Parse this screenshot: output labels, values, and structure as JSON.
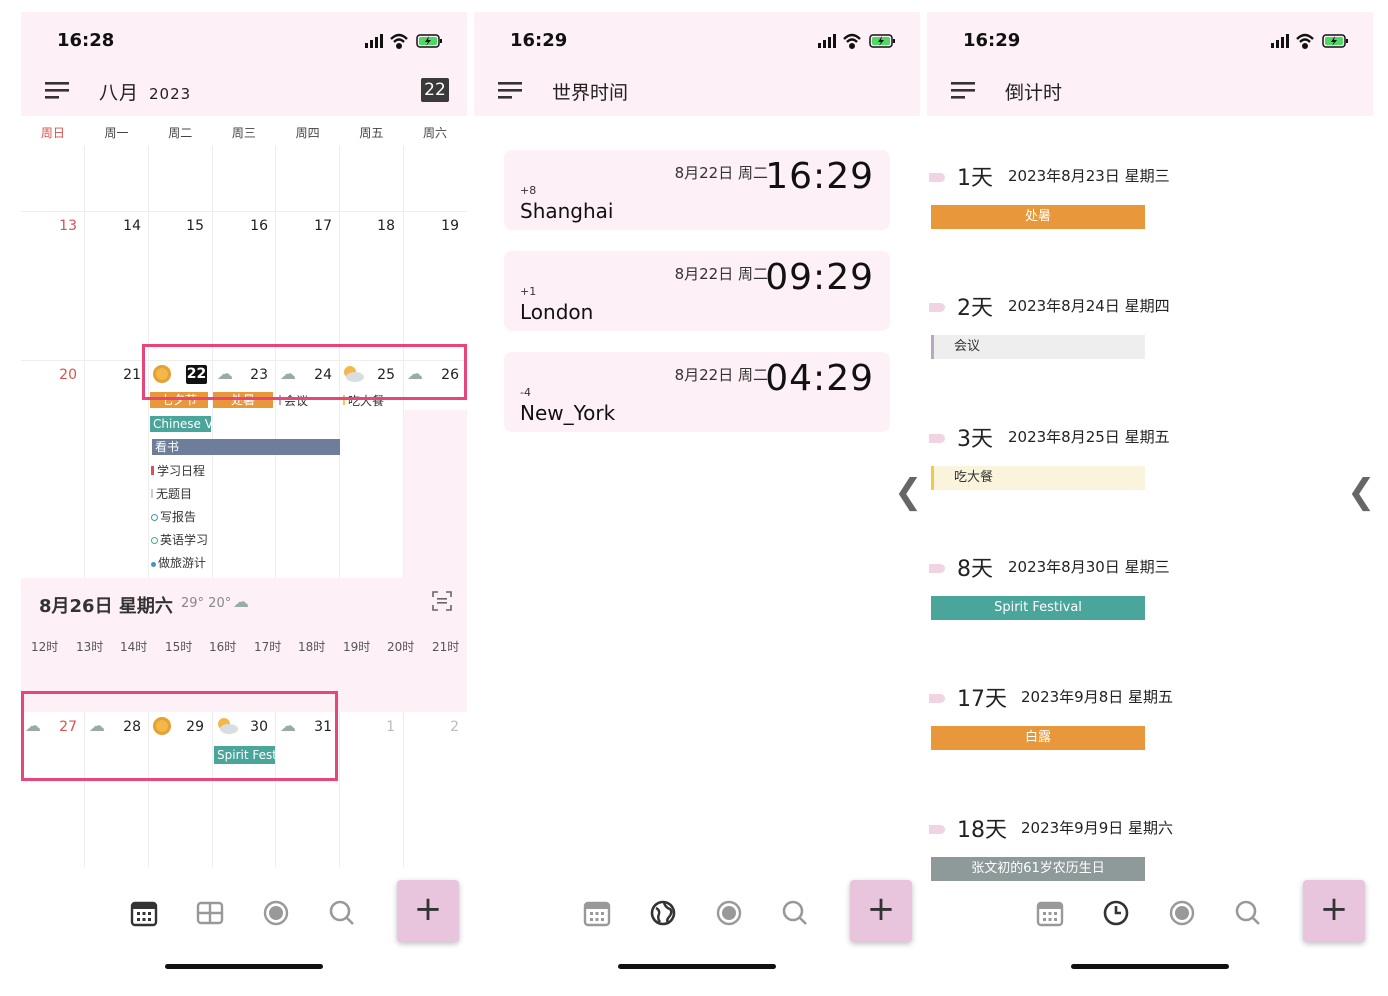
{
  "colors": {
    "accent_pink": "#fdf0f6",
    "highlight": "#e8457a",
    "orange": "#e8983a",
    "teal": "#4aa59a",
    "slate": "#6e7d99",
    "gray": "#8e9a9a"
  },
  "screen1": {
    "time": "16:28",
    "month": "八月",
    "year": "2023",
    "today": "22",
    "weekdays": [
      "周日",
      "周一",
      "周二",
      "周三",
      "周四",
      "周五",
      "周六"
    ],
    "week1": [
      "13",
      "14",
      "15",
      "16",
      "17",
      "18",
      "19"
    ],
    "week2": [
      "20",
      "21",
      "22",
      "23",
      "24",
      "25",
      "26"
    ],
    "week3": [
      "27",
      "28",
      "29",
      "30",
      "31",
      "1",
      "2"
    ],
    "events_week2": {
      "qixi": "七夕节",
      "chushu": "处暑",
      "meeting": "会议",
      "dinner": "吃大餐",
      "chinese": "Chinese V",
      "reading": "看书",
      "study_plan": "学习日程",
      "untitled": "无题目",
      "report": "写报告",
      "english": "英语学习",
      "travel": "做旅游计"
    },
    "day_panel": {
      "title": "8月26日 星期六",
      "temps": "29° 20°",
      "hours": [
        "12时",
        "13时",
        "14时",
        "15时",
        "16时",
        "17时",
        "18时",
        "19时",
        "20时",
        "21时"
      ]
    },
    "event_week3": "Spirit Fest"
  },
  "screen2": {
    "time": "16:29",
    "title": "世界时间",
    "cities": [
      {
        "offset": "+8",
        "city": "Shanghai",
        "date": "8月22日 周二",
        "time": "16:29"
      },
      {
        "offset": "+1",
        "city": "London",
        "date": "8月22日 周二",
        "time": "09:29"
      },
      {
        "offset": "-4",
        "city": "New_York",
        "date": "8月22日 周二",
        "time": "04:29"
      }
    ],
    "chevron": "❮"
  },
  "screen3": {
    "time": "16:29",
    "title": "倒计时",
    "items": [
      {
        "days": "1天",
        "date": "2023年8月23日 星期三",
        "event": "处暑",
        "color": "#e8983a",
        "style": "center"
      },
      {
        "days": "2天",
        "date": "2023年8月24日 星期四",
        "event": "会议",
        "color": "#eeeeee",
        "bar": "#b9a6c6",
        "style": "left"
      },
      {
        "days": "3天",
        "date": "2023年8月25日 星期五",
        "event": "吃大餐",
        "color": "#fbf4dc",
        "bar": "#f0c94a",
        "style": "left"
      },
      {
        "days": "8天",
        "date": "2023年8月30日 星期三",
        "event": "Spirit Festival",
        "color": "#4aa59a",
        "style": "center"
      },
      {
        "days": "17天",
        "date": "2023年9月8日 星期五",
        "event": "白露",
        "color": "#e8983a",
        "style": "center"
      },
      {
        "days": "18天",
        "date": "2023年9月9日 星期六",
        "event": "张文初的61岁农历生日",
        "color": "#8e9a9a",
        "style": "center"
      }
    ],
    "chevron": "❮"
  },
  "fab_label": "+"
}
